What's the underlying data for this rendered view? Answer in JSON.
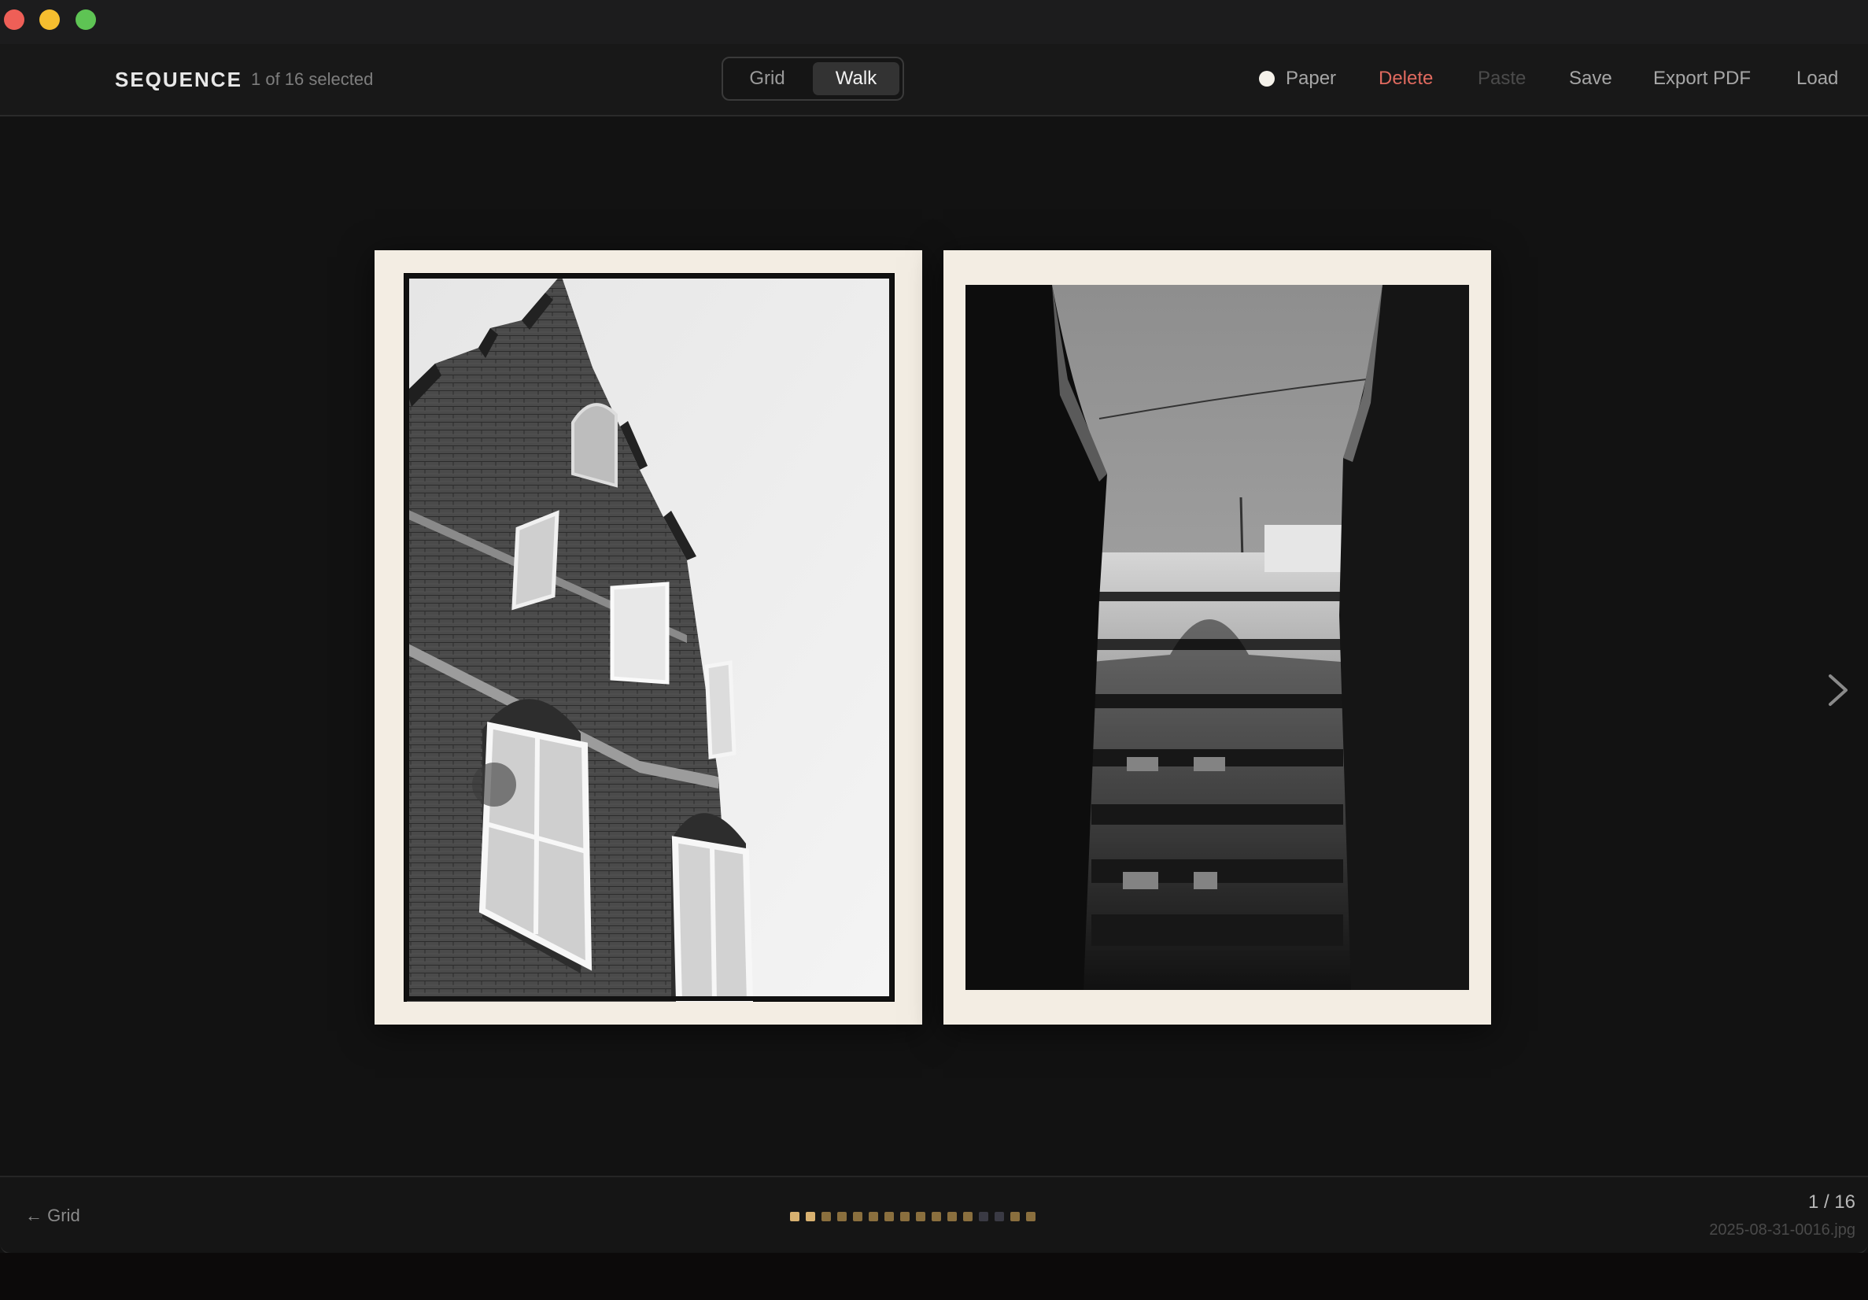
{
  "app": {
    "title": "SEQUENCE",
    "selection": "1 of 16 selected"
  },
  "view_toggle": {
    "grid": "Grid",
    "walk": "Walk",
    "active": "Walk"
  },
  "actions": {
    "paper": "Paper",
    "delete": "Delete",
    "paste": "Paste",
    "save": "Save",
    "export_pdf": "Export PDF",
    "load": "Load"
  },
  "colors": {
    "background": "#121212",
    "paper": "#f3ede3",
    "delete": "#e06a5f",
    "dot_active": "#d8b170",
    "dot_visited": "#8a6f3e",
    "dot_unvisited": "#3a3a44"
  },
  "stage": {
    "prints": [
      {
        "name": "photo-stepped-gable-brick-house",
        "subject": "stepped gable brick house"
      },
      {
        "name": "photo-narrow-street-buildings",
        "subject": "narrow street between buildings"
      }
    ],
    "next_icon": "chevron-right-icon"
  },
  "bottom": {
    "back_label": "← Grid",
    "counter": "1 / 16",
    "filename": "2025-08-31-0016.jpg",
    "total": 16,
    "current": 1,
    "dot_states": [
      "active",
      "active",
      "visited",
      "visited",
      "visited",
      "visited",
      "visited",
      "visited",
      "visited",
      "visited",
      "visited",
      "visited",
      "unvisited",
      "unvisited",
      "visited",
      "visited"
    ]
  }
}
